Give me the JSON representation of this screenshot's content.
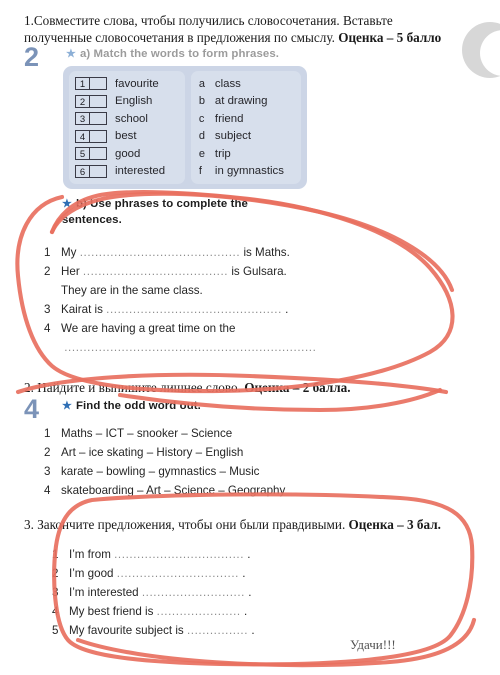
{
  "document": {
    "type": "scanned-worksheet",
    "accent_blue": "#7b93b8",
    "star_blue": "#2f6fb5",
    "annotation_red": "#e8705f",
    "match_box_bg": "#ccd5e6"
  },
  "task1": {
    "instruction_line1": "1.Совместите слова, чтобы получились словосочетания. Вставьте",
    "instruction_line2_plain": "полученные словосочетания в предложения по смыслу. ",
    "instruction_line2_bold": "Оценка – 5 балло",
    "unit_number": "2",
    "part_a_heading": "a) Match the words to form phrases.",
    "part_a_star": "★",
    "left_items": [
      {
        "num": "1",
        "word": "favourite",
        "answer": ""
      },
      {
        "num": "2",
        "word": "English",
        "answer": ""
      },
      {
        "num": "3",
        "word": "school",
        "answer": ""
      },
      {
        "num": "4",
        "word": "best",
        "answer": ""
      },
      {
        "num": "5",
        "word": "good",
        "answer": ""
      },
      {
        "num": "6",
        "word": "interested",
        "answer": ""
      }
    ],
    "right_items": [
      {
        "letter": "a",
        "word": "class"
      },
      {
        "letter": "b",
        "word": "at drawing"
      },
      {
        "letter": "c",
        "word": "friend"
      },
      {
        "letter": "d",
        "word": "subject"
      },
      {
        "letter": "e",
        "word": "trip"
      },
      {
        "letter": "f",
        "word": "in gymnastics"
      }
    ],
    "part_b_star": "★",
    "part_b_heading_line1": "b) Use phrases to complete the",
    "part_b_heading_line2": "sentences.",
    "sentences": [
      {
        "idx": "1",
        "before": "My",
        "dots": "..........................................",
        "after": "is Maths."
      },
      {
        "idx": "2",
        "before": "Her",
        "dots": "......................................",
        "after": "is Gulsara."
      },
      {
        "idx": "",
        "before": "They are in the same class.",
        "dots": "",
        "after": ""
      },
      {
        "idx": "3",
        "before": "Kairat is",
        "dots": "..............................................",
        "after": "."
      },
      {
        "idx": "4",
        "before": "We are having a great time on the",
        "dots": "..............",
        "after": ""
      },
      {
        "idx": "",
        "before": "",
        "dots": "..................................................................",
        "after": "."
      }
    ]
  },
  "task2": {
    "instruction_plain": "2. Найдите и выпишите лишнее слово. ",
    "instruction_bold": "Оценка – 2 балла.",
    "unit_number": "4",
    "star": "★",
    "heading": "Find the odd word out.",
    "items": [
      {
        "idx": "1",
        "text": "Maths – ICT – snooker – Science"
      },
      {
        "idx": "2",
        "text": "Art – ice skating – History – English"
      },
      {
        "idx": "3",
        "text": "karate – bowling – gymnastics – Music"
      },
      {
        "idx": "4",
        "text": "skateboarding – Art – Science – Geography"
      }
    ]
  },
  "task3": {
    "instruction_plain": "3. Закончите предложения, чтобы они были правдивыми. ",
    "instruction_bold": "Оценка – 3 бал.",
    "items": [
      {
        "idx": "1",
        "text": "I’m from",
        "dots": "..................................",
        "end": "."
      },
      {
        "idx": "2",
        "text": "I’m good",
        "dots": "................................",
        "end": "."
      },
      {
        "idx": "3",
        "text": "I’m interested",
        "dots": "...........................",
        "end": "."
      },
      {
        "idx": "4",
        "text": "My best friend is",
        "dots": "......................",
        "end": "."
      },
      {
        "idx": "5",
        "text": "My favourite subject is",
        "dots": "................",
        "end": "."
      }
    ],
    "closing": "Удачи!!!"
  }
}
